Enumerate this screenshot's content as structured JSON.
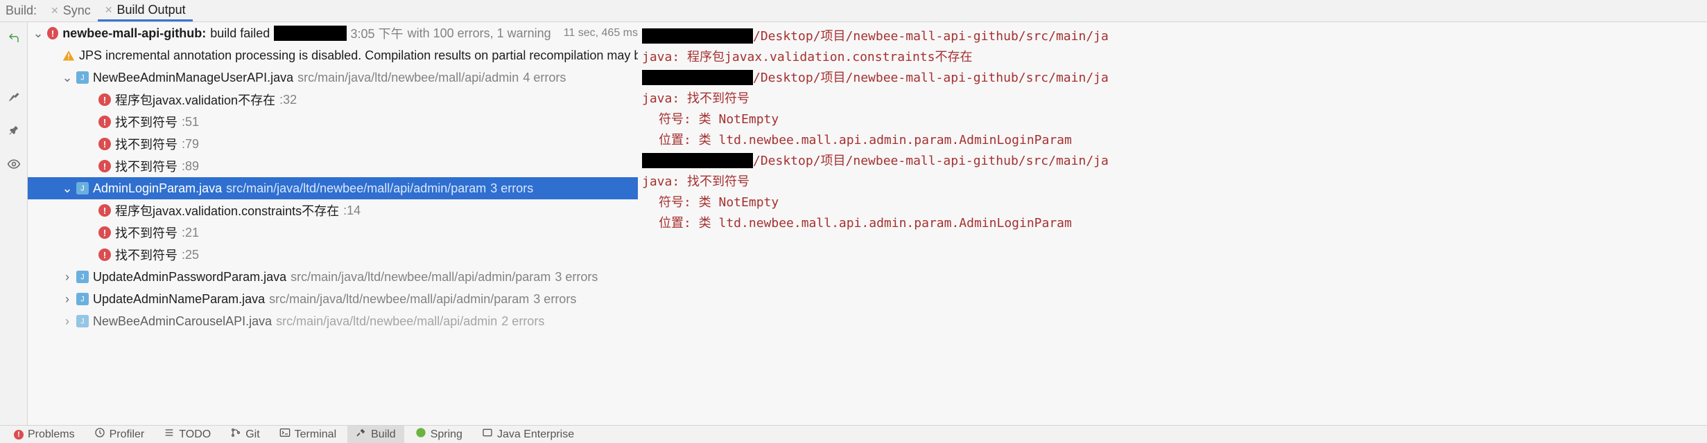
{
  "topbar": {
    "label": "Build:",
    "tabs": [
      {
        "name": "Sync",
        "active": false
      },
      {
        "name": "Build Output",
        "active": true
      }
    ]
  },
  "tree": {
    "root": {
      "name": "newbee-mall-api-github:",
      "status": "build failed",
      "time": "3:05 下午",
      "with": "with 100 errors, 1 warning",
      "duration": "11 sec, 465 ms"
    },
    "warning": "JPS incremental annotation processing is disabled. Compilation results on partial recompilation may b",
    "files": [
      {
        "name": "NewBeeAdminManageUserAPI.java",
        "path": "src/main/java/ltd/newbee/mall/api/admin",
        "errcount": "4 errors",
        "expanded": true,
        "errors": [
          {
            "msg": "程序包javax.validation不存在",
            "line": ":32"
          },
          {
            "msg": "找不到符号",
            "line": ":51"
          },
          {
            "msg": "找不到符号",
            "line": ":79"
          },
          {
            "msg": "找不到符号",
            "line": ":89"
          }
        ]
      },
      {
        "name": "AdminLoginParam.java",
        "path": "src/main/java/ltd/newbee/mall/api/admin/param",
        "errcount": "3 errors",
        "expanded": true,
        "selected": true,
        "errors": [
          {
            "msg": "程序包javax.validation.constraints不存在",
            "line": ":14"
          },
          {
            "msg": "找不到符号",
            "line": ":21"
          },
          {
            "msg": "找不到符号",
            "line": ":25"
          }
        ]
      },
      {
        "name": "UpdateAdminPasswordParam.java",
        "path": "src/main/java/ltd/newbee/mall/api/admin/param",
        "errcount": "3 errors",
        "expanded": false
      },
      {
        "name": "UpdateAdminNameParam.java",
        "path": "src/main/java/ltd/newbee/mall/api/admin/param",
        "errcount": "3 errors",
        "expanded": false
      },
      {
        "name": "NewBeeAdminCarouselAPI.java",
        "path": "src/main/java/ltd/newbee/mall/api/admin",
        "errcount": "2 errors",
        "expanded": false
      }
    ]
  },
  "console": {
    "lines": [
      {
        "redact": true,
        "text": "/Desktop/项目/newbee-mall-api-github/src/main/ja"
      },
      {
        "text": "java: 程序包javax.validation.constraints不存在"
      },
      {
        "redact": true,
        "text": "/Desktop/项目/newbee-mall-api-github/src/main/ja"
      },
      {
        "text": "java: 找不到符号"
      },
      {
        "indent": true,
        "text": "符号:   类 NotEmpty"
      },
      {
        "indent": true,
        "text": "位置: 类 ltd.newbee.mall.api.admin.param.AdminLoginParam"
      },
      {
        "redact": true,
        "text": "/Desktop/项目/newbee-mall-api-github/src/main/ja"
      },
      {
        "text": "java: 找不到符号"
      },
      {
        "indent": true,
        "text": "符号:   类 NotEmpty"
      },
      {
        "indent": true,
        "text": "位置: 类 ltd.newbee.mall.api.admin.param.AdminLoginParam"
      }
    ]
  },
  "statusbar": {
    "items": [
      {
        "name": "Problems",
        "icon": "problem"
      },
      {
        "name": "Profiler",
        "icon": "profiler"
      },
      {
        "name": "TODO",
        "icon": "todo"
      },
      {
        "name": "Git",
        "icon": "git"
      },
      {
        "name": "Terminal",
        "icon": "terminal"
      },
      {
        "name": "Build",
        "icon": "build",
        "active": true
      },
      {
        "name": "Spring",
        "icon": "spring"
      },
      {
        "name": "Java Enterprise",
        "icon": "javaee"
      }
    ]
  }
}
